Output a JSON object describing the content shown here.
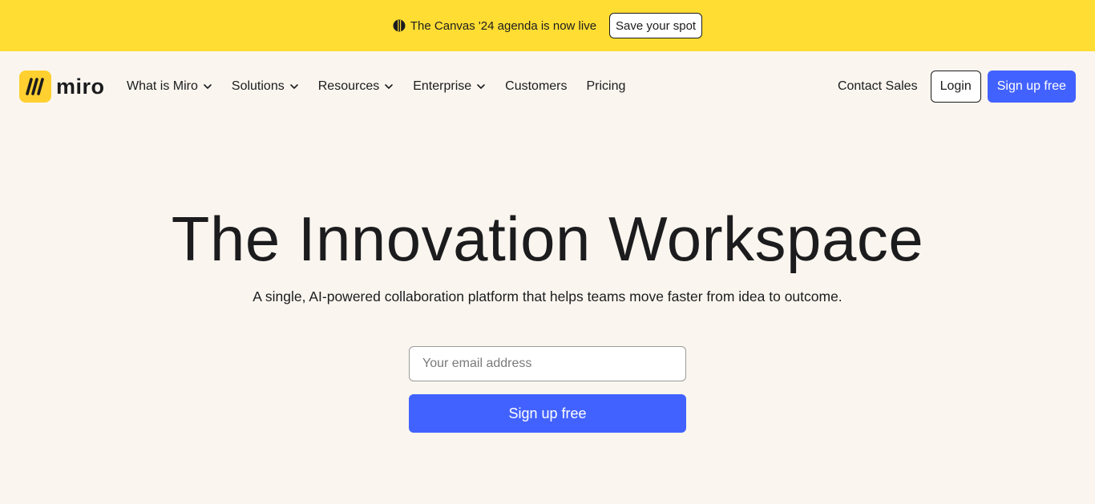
{
  "announcement": {
    "icon": "canvas-logo-icon",
    "text": "The Canvas '24 agenda is now live",
    "cta_label": "Save your spot",
    "background": "#ffdd33"
  },
  "nav": {
    "logo_text": "miro",
    "items": [
      {
        "label": "What is Miro",
        "has_dropdown": true
      },
      {
        "label": "Solutions",
        "has_dropdown": true
      },
      {
        "label": "Resources",
        "has_dropdown": true
      },
      {
        "label": "Enterprise",
        "has_dropdown": true
      },
      {
        "label": "Customers",
        "has_dropdown": false
      },
      {
        "label": "Pricing",
        "has_dropdown": false
      }
    ],
    "contact_label": "Contact Sales",
    "login_label": "Login",
    "signup_label": "Sign up free"
  },
  "hero": {
    "title": "The Innovation Workspace",
    "subtitle": "A single, AI-powered collaboration platform that helps teams move faster from idea to outcome.",
    "email_placeholder": "Your email address",
    "signup_label": "Sign up free"
  },
  "colors": {
    "brand_blue": "#4262ff",
    "brand_yellow": "#ffd02f",
    "page_background": "#faf6ef"
  }
}
